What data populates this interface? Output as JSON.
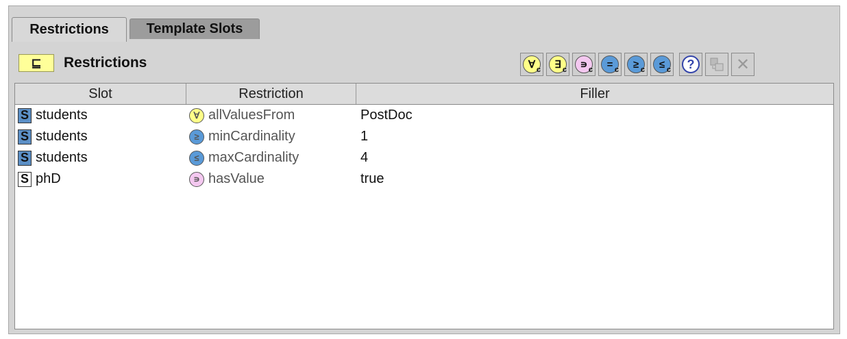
{
  "tabs": [
    {
      "label": "Restrictions",
      "active": true
    },
    {
      "label": "Template Slots",
      "active": false
    }
  ],
  "header": {
    "icon": "⊑",
    "title": "Restrictions"
  },
  "toolbar": [
    {
      "name": "all-values-from-button",
      "glyph": "∀",
      "sub": "c",
      "style": "yellow"
    },
    {
      "name": "some-values-from-button",
      "glyph": "∃",
      "sub": "c",
      "style": "yellow"
    },
    {
      "name": "has-value-button",
      "glyph": "∍",
      "sub": "c",
      "style": "pink"
    },
    {
      "name": "cardinality-button",
      "glyph": "=",
      "sub": "c",
      "style": "blue"
    },
    {
      "name": "min-cardinality-button",
      "glyph": "≥",
      "sub": "c",
      "style": "blue"
    },
    {
      "name": "max-cardinality-button",
      "glyph": "≤",
      "sub": "c",
      "style": "blue"
    }
  ],
  "help_glyph": "?",
  "delete_glyph": "✕",
  "columns": [
    "Slot",
    "Restriction",
    "Filler"
  ],
  "rows": [
    {
      "slot": "students",
      "restriction": "allValuesFrom",
      "filler": "PostDoc",
      "slot_icon": "S",
      "r_glyph": "∀",
      "r_color": "#ffff88",
      "slot_style": "filled"
    },
    {
      "slot": "students",
      "restriction": "minCardinality",
      "filler": "1",
      "slot_icon": "S",
      "r_glyph": "≥",
      "r_color": "#5a9ad8",
      "slot_style": "filled"
    },
    {
      "slot": "students",
      "restriction": "maxCardinality",
      "filler": "4",
      "slot_icon": "S",
      "r_glyph": "≤",
      "r_color": "#5a9ad8",
      "slot_style": "filled"
    },
    {
      "slot": "phD",
      "restriction": "hasValue",
      "filler": "true",
      "slot_icon": "S",
      "r_glyph": "∍",
      "r_color": "#f4c8f0",
      "slot_style": "plain"
    }
  ]
}
